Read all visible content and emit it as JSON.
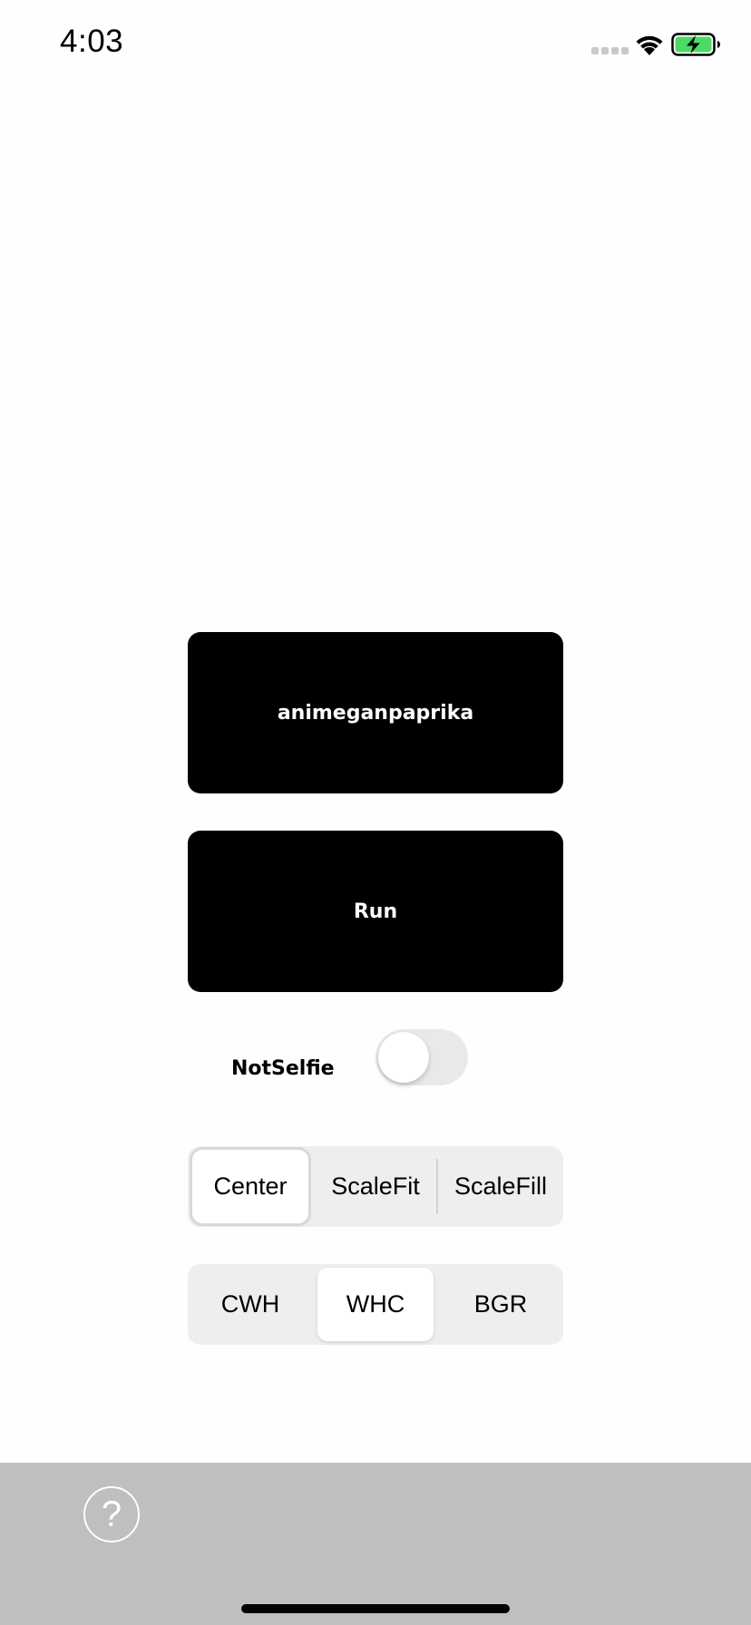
{
  "status_bar": {
    "time": "4:03",
    "icons": [
      "signal-dots-icon",
      "wifi-icon",
      "battery-charging-icon"
    ],
    "battery_color": "#4cd964"
  },
  "main": {
    "model_button_label": "animeganpaprika",
    "run_button_label": "Run",
    "selfie_toggle": {
      "label": "NotSelfie",
      "on": false
    },
    "scaling_segment": {
      "options": [
        "Center",
        "ScaleFit",
        "ScaleFill"
      ],
      "selected": "Center"
    },
    "layout_segment": {
      "options": [
        "CWH",
        "WHC",
        "BGR"
      ],
      "selected": "WHC"
    }
  },
  "bottom_bar": {
    "help_icon": "question-mark-icon",
    "help_symbol": "?",
    "background": "#bfbfbf"
  },
  "colors": {
    "button_background": "#000000",
    "button_text": "#ffffff",
    "segment_background": "#eeeeef",
    "toggle_off": "#e9e9ea"
  }
}
